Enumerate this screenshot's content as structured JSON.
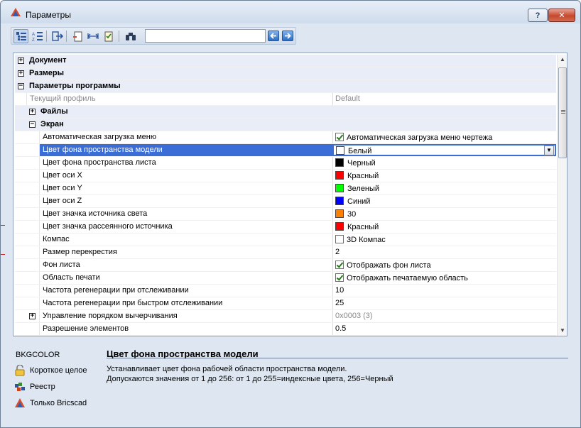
{
  "window": {
    "title": "Параметры",
    "help_label": "?",
    "close_label": "✕"
  },
  "toolbar": {
    "search_value": "",
    "search_placeholder": ""
  },
  "grid": {
    "categories": {
      "document": "Документ",
      "dimensions": "Размеры",
      "program_params": "Параметры программы",
      "files": "Файлы",
      "screen": "Экран"
    },
    "profile": {
      "label": "Текущий профиль",
      "value": "Default"
    },
    "props": [
      {
        "label": "Автоматическая загрузка меню",
        "value": "Автоматическая загрузка меню чертежа",
        "check": true
      },
      {
        "label": "Цвет фона пространства модели",
        "value": "Белый",
        "color": "#ffffff"
      },
      {
        "label": "Цвет фона пространства листа",
        "value": "Черный",
        "color": "#000000"
      },
      {
        "label": "Цвет оси X",
        "value": "Красный",
        "color": "#ff0000"
      },
      {
        "label": "Цвет оси Y",
        "value": "Зеленый",
        "color": "#00ff00"
      },
      {
        "label": "Цвет оси Z",
        "value": "Синий",
        "color": "#0000ff"
      },
      {
        "label": "Цвет значка источника света",
        "value": "30",
        "color": "#ff7f00"
      },
      {
        "label": "Цвет значка рассеянного источника",
        "value": "Красный",
        "color": "#ff0000"
      },
      {
        "label": "Компас",
        "value": "3D Компас",
        "check": false
      },
      {
        "label": "Размер перекрестия",
        "value": "2"
      },
      {
        "label": "Фон листа",
        "value": "Отображать фон листа",
        "check": true
      },
      {
        "label": "Область печати",
        "value": "Отображать печатаемую область",
        "check": true
      },
      {
        "label": "Частота регенерации при отслеживании",
        "value": "10"
      },
      {
        "label": "Частота регенерации при быстром отслеживании",
        "value": "25"
      },
      {
        "label": "Управление порядком вычерчивания",
        "value": "0x0003 (3)"
      },
      {
        "label": "Разрешение элементов",
        "value": "0.5"
      }
    ]
  },
  "info": {
    "variable": "BKGCOLOR",
    "links": [
      "Короткое целое",
      "Реестр",
      "Только Bricscad"
    ],
    "title": "Цвет фона пространства модели",
    "line1": "Устанавливает цвет фона рабочей области пространства модели.",
    "line2": "Допускаются значения от 1 до 256: от 1 до 255=индексные цвета, 256=Черный"
  }
}
